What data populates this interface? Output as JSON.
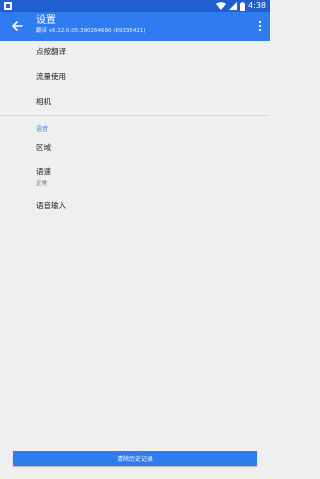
{
  "statusbar": {
    "time": "4:38",
    "icons": [
      "notification-icon",
      "wifi-icon",
      "signal-icon",
      "battery-icon"
    ]
  },
  "appbar": {
    "title": "设置",
    "subtitle": "翻译 v6.22.0.05.390264690 (69335421)"
  },
  "settings": {
    "items": [
      {
        "label": "点按翻译"
      },
      {
        "label": "流量使用"
      },
      {
        "label": "相机"
      }
    ],
    "section_title": "语音",
    "voice_items": [
      {
        "label": "区域"
      },
      {
        "label": "语速",
        "value": "正常"
      },
      {
        "label": "语音输入"
      }
    ]
  },
  "bottom_button": {
    "label": "清除历史记录"
  },
  "colors": {
    "primary": "#2f7cf0",
    "statusbar": "#1f5fd0",
    "background": "#efefef"
  }
}
